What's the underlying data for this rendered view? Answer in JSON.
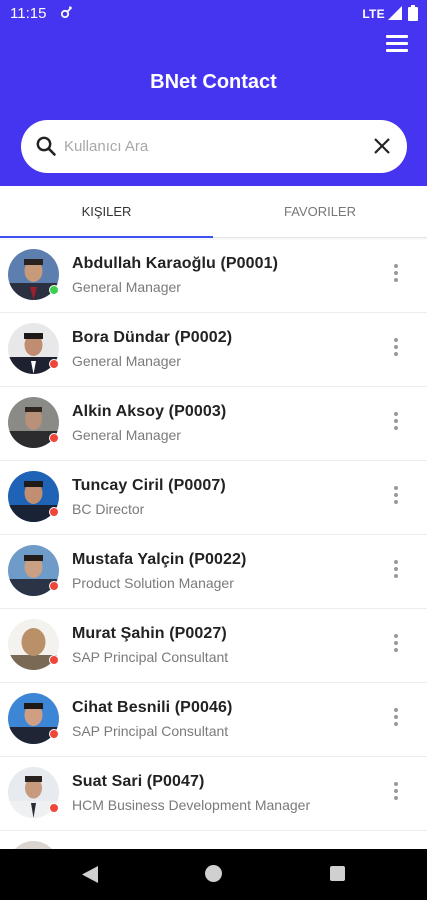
{
  "status_bar": {
    "time": "11:15",
    "network": "LTE"
  },
  "app": {
    "title": "BNet Contact"
  },
  "search": {
    "placeholder": "Kullanıcı Ara",
    "value": ""
  },
  "tabs": [
    {
      "label": "KIŞILER",
      "active": true
    },
    {
      "label": "FAVORILER",
      "active": false
    }
  ],
  "colors": {
    "header": "#4635f0",
    "online": "#3ccf4e",
    "offline": "#f0453a",
    "tab_indicator": "#3f51f5"
  },
  "contacts": [
    {
      "name": "Abdullah Karaoğlu (P0001)",
      "role": "General Manager",
      "status": "online"
    },
    {
      "name": "Bora Dündar (P0002)",
      "role": "General Manager",
      "status": "offline"
    },
    {
      "name": "Alkin Aksoy (P0003)",
      "role": "General Manager",
      "status": "offline"
    },
    {
      "name": "Tuncay Ciril (P0007)",
      "role": "BC Director",
      "status": "offline"
    },
    {
      "name": "Mustafa Yalçin (P0022)",
      "role": "Product Solution Manager",
      "status": "offline"
    },
    {
      "name": "Murat Şahin (P0027)",
      "role": "SAP Principal Consultant",
      "status": "offline"
    },
    {
      "name": "Cihat Besnili (P0046)",
      "role": "SAP Principal Consultant",
      "status": "offline"
    },
    {
      "name": "Suat Sari (P0047)",
      "role": "HCM Business Development Manager",
      "status": "offline"
    }
  ]
}
